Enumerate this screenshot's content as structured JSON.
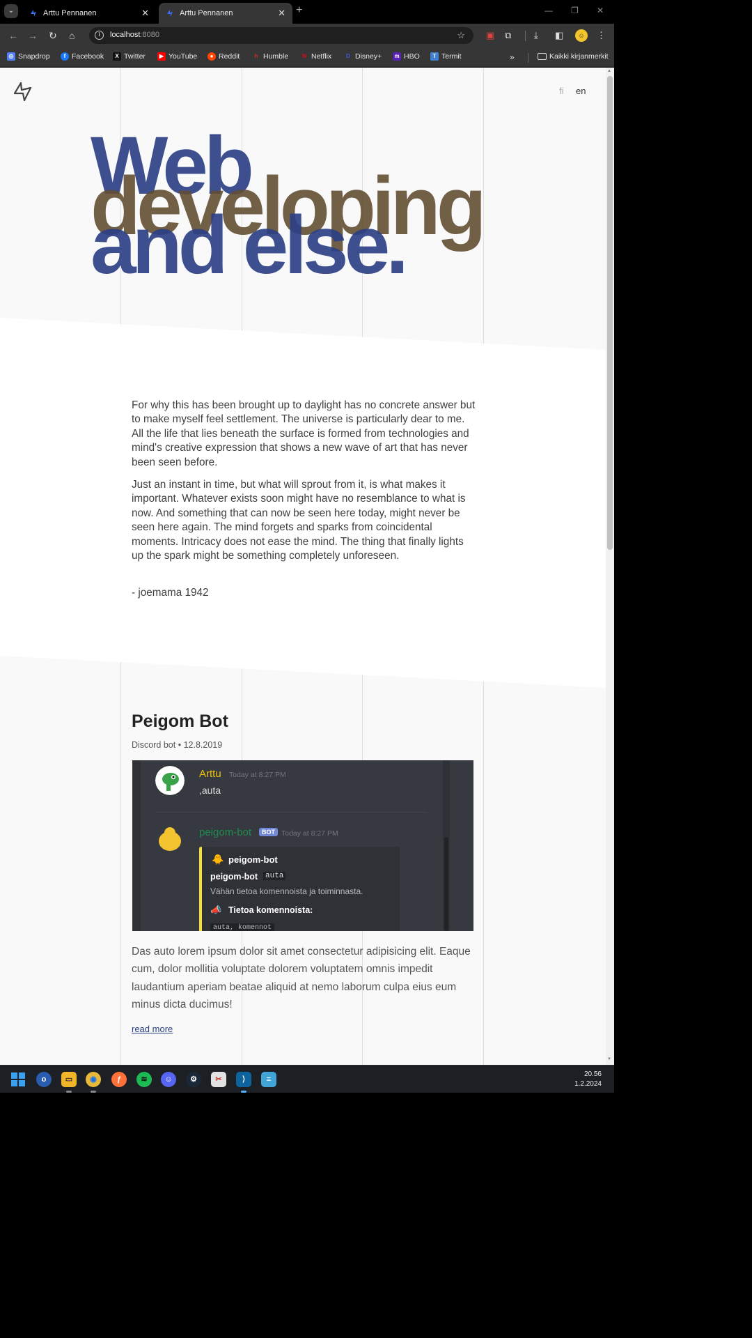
{
  "browser": {
    "tabs": [
      {
        "title": "Arttu Pennanen",
        "active": false
      },
      {
        "title": "Arttu Pennanen",
        "active": true
      }
    ],
    "url_host": "localhost",
    "url_port": ":8080",
    "bookmarks": [
      {
        "label": "Snapdrop",
        "icon": "snapdrop-icon",
        "color": "#4f7df2"
      },
      {
        "label": "Facebook",
        "icon": "facebook-icon",
        "color": "#1877f2"
      },
      {
        "label": "Twitter",
        "icon": "twitter-icon",
        "color": "#111111"
      },
      {
        "label": "YouTube",
        "icon": "youtube-icon",
        "color": "#ff0000"
      },
      {
        "label": "Reddit",
        "icon": "reddit-icon",
        "color": "#ff4500"
      },
      {
        "label": "Humble",
        "icon": "humble-icon",
        "color": "#cc2929"
      },
      {
        "label": "Netflix",
        "icon": "netflix-icon",
        "color": "#e50914"
      },
      {
        "label": "Disney+",
        "icon": "disney-icon",
        "color": "#1a3fa6"
      },
      {
        "label": "HBO",
        "icon": "hbo-icon",
        "color": "#5822b4"
      },
      {
        "label": "Termit",
        "icon": "termit-icon",
        "color": "#3f7fd0"
      }
    ],
    "bookmarks_folder": "Kaikki kirjanmerkit"
  },
  "page": {
    "lang_fi": "fi",
    "lang_en": "en",
    "hero": [
      "Web",
      "developing",
      "and else."
    ],
    "hero_colors": {
      "blue": "#2c4085",
      "brown": "#624e32"
    },
    "paragraphs": [
      "For why this has been brought up to daylight has no concrete answer but to make myself feel settlement. The universe is particularly dear to me. All the life that lies beneath the surface is formed from technologies and mind's creative expression that shows a new wave of art that has never been seen before.",
      "Just an instant in time, but what will sprout from it, is what makes it important. Whatever exists soon might have no resemblance to what is now. And something that can now be seen here today, might never be seen here again. The mind forgets and sparks from coincidental moments. Intricacy does not ease the mind. The thing that finally lights up the spark might be something completely unforeseen."
    ],
    "signature": "- joemama 1942",
    "post": {
      "title": "Peigom Bot",
      "category": "Discord bot",
      "date": "12.8.2019",
      "description": "Das auto lorem ipsum dolor sit amet consectetur adipisicing elit. Eaque cum, dolor mollitia voluptate dolorem voluptatem omnis impedit laudantium aperiam beatae aliquid at nemo laborum culpa eius eum minus dicta ducimus!",
      "read_more": "read more",
      "screenshot": {
        "user_name": "Arttu",
        "user_time": "Today at 8:27 PM",
        "user_message": ",auta",
        "bot_name": "peigom-bot",
        "bot_badge": "BOT",
        "bot_time": "Today at 8:27 PM",
        "embed_author": "peigom-bot",
        "embed_cmd_name": "peigom-bot",
        "embed_cmd": "auta",
        "embed_desc": "Vähän tietoa komennoista ja toiminnasta.",
        "embed_section": "Tietoa komennoista:",
        "embed_cut": "auta, komennot"
      }
    }
  },
  "taskbar": {
    "time": "20.56",
    "date": "1.2.2024"
  }
}
